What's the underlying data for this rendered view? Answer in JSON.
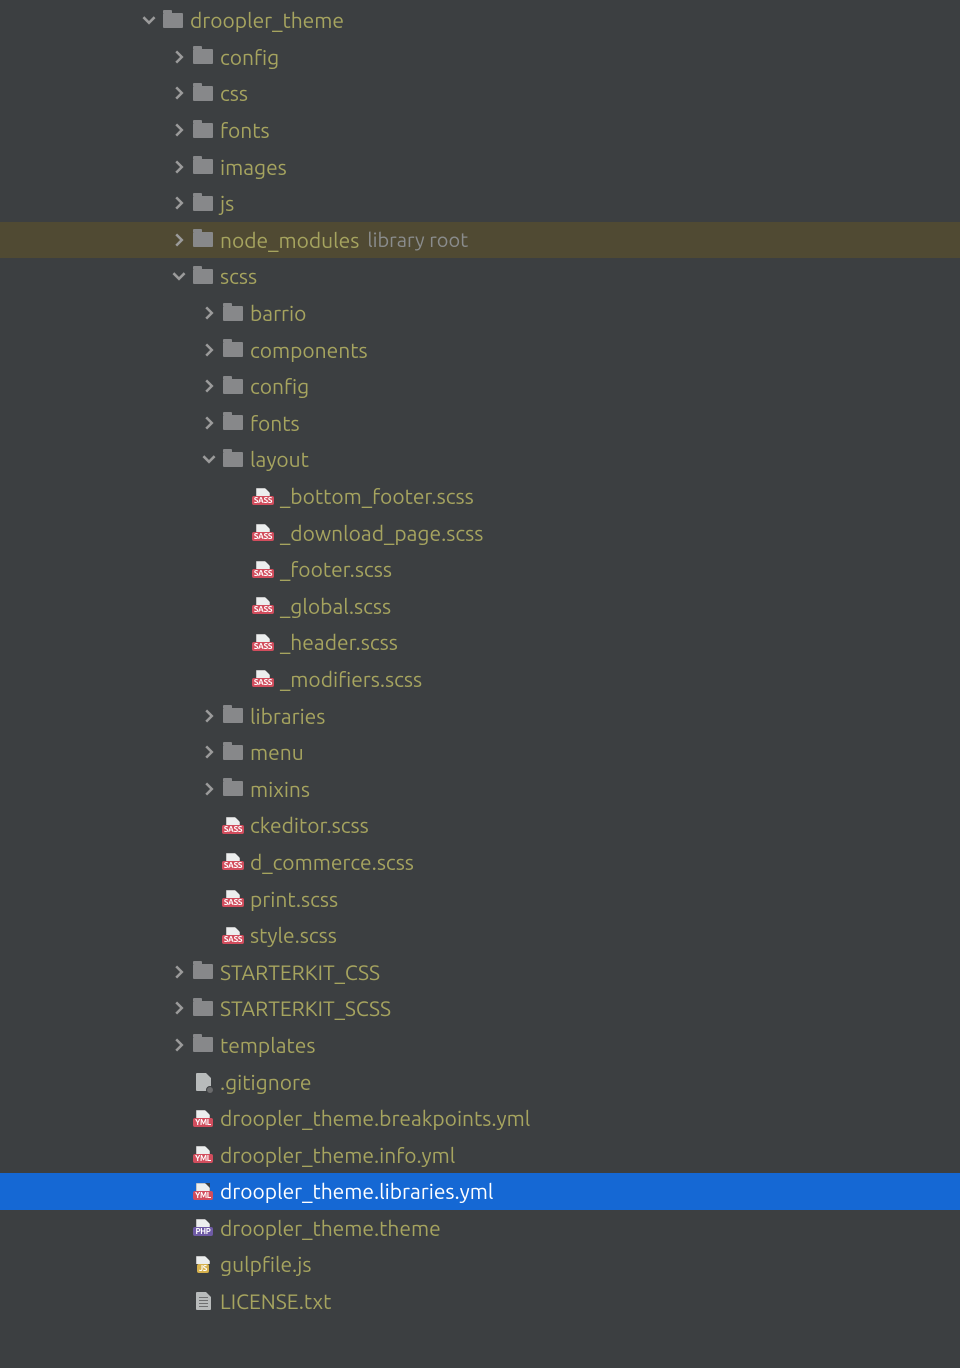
{
  "indent_base": 138,
  "indent_step": 30,
  "nodes": [
    {
      "depth": 0,
      "arrow": "down",
      "icon": "folder",
      "label": "droopler_theme"
    },
    {
      "depth": 1,
      "arrow": "right",
      "icon": "folder",
      "label": "config"
    },
    {
      "depth": 1,
      "arrow": "right",
      "icon": "folder",
      "label": "css"
    },
    {
      "depth": 1,
      "arrow": "right",
      "icon": "folder",
      "label": "fonts"
    },
    {
      "depth": 1,
      "arrow": "right",
      "icon": "folder",
      "label": "images"
    },
    {
      "depth": 1,
      "arrow": "right",
      "icon": "folder",
      "label": "js"
    },
    {
      "depth": 1,
      "arrow": "right",
      "icon": "folder",
      "label": "node_modules",
      "suffix": "library root",
      "rowClass": "library-root"
    },
    {
      "depth": 1,
      "arrow": "down",
      "icon": "folder",
      "label": "scss"
    },
    {
      "depth": 2,
      "arrow": "right",
      "icon": "folder",
      "label": "barrio"
    },
    {
      "depth": 2,
      "arrow": "right",
      "icon": "folder",
      "label": "components"
    },
    {
      "depth": 2,
      "arrow": "right",
      "icon": "folder",
      "label": "config"
    },
    {
      "depth": 2,
      "arrow": "right",
      "icon": "folder",
      "label": "fonts"
    },
    {
      "depth": 2,
      "arrow": "down",
      "icon": "folder",
      "label": "layout"
    },
    {
      "depth": 3,
      "arrow": "none",
      "icon": "sass",
      "label": "_bottom_footer.scss"
    },
    {
      "depth": 3,
      "arrow": "none",
      "icon": "sass",
      "label": "_download_page.scss"
    },
    {
      "depth": 3,
      "arrow": "none",
      "icon": "sass",
      "label": "_footer.scss"
    },
    {
      "depth": 3,
      "arrow": "none",
      "icon": "sass",
      "label": "_global.scss"
    },
    {
      "depth": 3,
      "arrow": "none",
      "icon": "sass",
      "label": "_header.scss"
    },
    {
      "depth": 3,
      "arrow": "none",
      "icon": "sass",
      "label": "_modifiers.scss"
    },
    {
      "depth": 2,
      "arrow": "right",
      "icon": "folder",
      "label": "libraries"
    },
    {
      "depth": 2,
      "arrow": "right",
      "icon": "folder",
      "label": "menu"
    },
    {
      "depth": 2,
      "arrow": "right",
      "icon": "folder",
      "label": "mixins"
    },
    {
      "depth": 2,
      "arrow": "none",
      "icon": "sass",
      "label": "ckeditor.scss"
    },
    {
      "depth": 2,
      "arrow": "none",
      "icon": "sass",
      "label": "d_commerce.scss"
    },
    {
      "depth": 2,
      "arrow": "none",
      "icon": "sass",
      "label": "print.scss"
    },
    {
      "depth": 2,
      "arrow": "none",
      "icon": "sass",
      "label": "style.scss"
    },
    {
      "depth": 1,
      "arrow": "right",
      "icon": "folder",
      "label": "STARTERKIT_CSS"
    },
    {
      "depth": 1,
      "arrow": "right",
      "icon": "folder",
      "label": "STARTERKIT_SCSS"
    },
    {
      "depth": 1,
      "arrow": "right",
      "icon": "folder",
      "label": "templates"
    },
    {
      "depth": 1,
      "arrow": "none",
      "icon": "gitignore",
      "label": ".gitignore"
    },
    {
      "depth": 1,
      "arrow": "none",
      "icon": "yml",
      "label": "droopler_theme.breakpoints.yml"
    },
    {
      "depth": 1,
      "arrow": "none",
      "icon": "yml",
      "label": "droopler_theme.info.yml"
    },
    {
      "depth": 1,
      "arrow": "none",
      "icon": "yml",
      "label": "droopler_theme.libraries.yml",
      "rowClass": "selected"
    },
    {
      "depth": 1,
      "arrow": "none",
      "icon": "php",
      "label": "droopler_theme.theme"
    },
    {
      "depth": 1,
      "arrow": "none",
      "icon": "js",
      "label": "gulpfile.js"
    },
    {
      "depth": 1,
      "arrow": "none",
      "icon": "txt",
      "label": "LICENSE.txt"
    }
  ],
  "iconTags": {
    "sass": "SASS",
    "yml": "YML",
    "php": "PHP",
    "js": "JS"
  }
}
